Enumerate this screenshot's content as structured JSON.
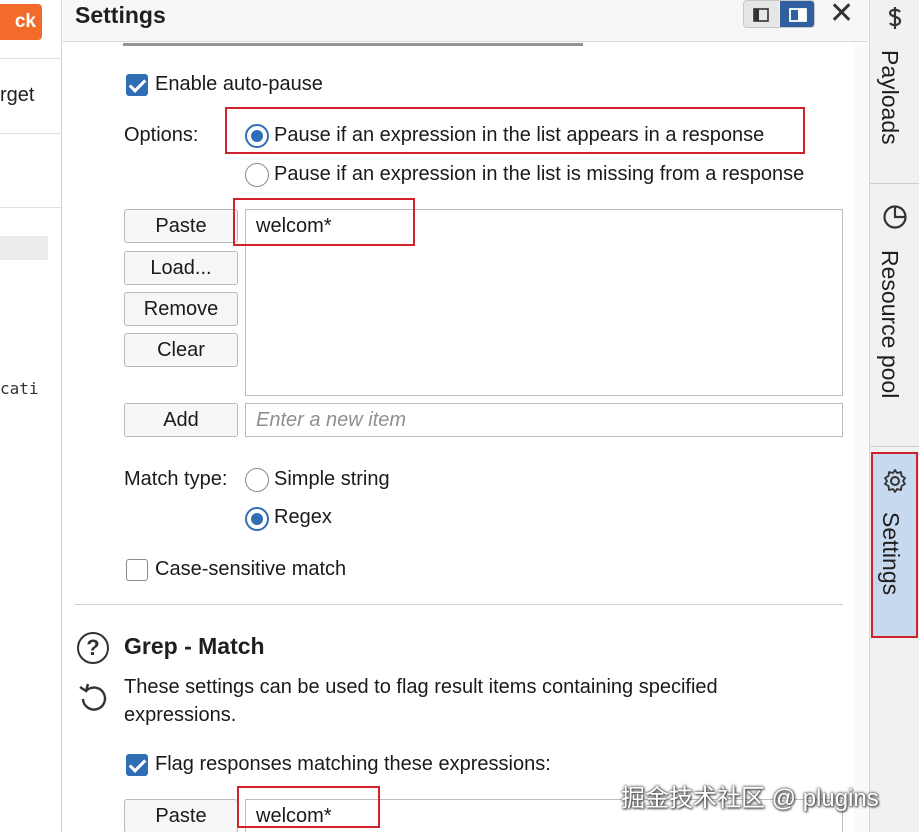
{
  "left_pane": {
    "button_label": "ck",
    "target_label": "rget",
    "mono_text": "cati"
  },
  "settings_panel": {
    "title": "Settings",
    "enable_auto_pause_label": "Enable auto-pause",
    "enable_auto_pause_checked": true,
    "options_label": "Options:",
    "option_appears_label": "Pause if an expression in the list appears in a response",
    "option_missing_label": "Pause if an expression in the list is missing from a response",
    "selected_option": "appears",
    "list_buttons": {
      "paste": "Paste",
      "load": "Load...",
      "remove": "Remove",
      "clear": "Clear",
      "add": "Add"
    },
    "list_items": [
      "welcom*"
    ],
    "new_item_placeholder": "Enter a new item",
    "match_type_label": "Match type:",
    "match_simple_label": "Simple string",
    "match_regex_label": "Regex",
    "selected_match_type": "regex",
    "case_sensitive_label": "Case-sensitive match",
    "case_sensitive_checked": false
  },
  "grep_match": {
    "title": "Grep - Match",
    "description_line1": "These settings can be used to flag result items containing specified",
    "description_line2": "expressions.",
    "flag_label": "Flag responses matching these expressions:",
    "flag_checked": true,
    "paste_label": "Paste",
    "list_items": [
      "welcom*"
    ]
  },
  "right_tabs": [
    {
      "label": "Payloads",
      "icon": "dollar-icon",
      "active": false
    },
    {
      "label": "Resource pool",
      "icon": "pie-chart-icon",
      "active": false
    },
    {
      "label": "Settings",
      "icon": "gear-icon",
      "active": true
    }
  ],
  "watermark": "掘金技术社区 @ plugins",
  "colors": {
    "accent_blue": "#2f6eb5",
    "highlight_red": "#d0222c",
    "active_tab_bg": "#c7d9ef",
    "orange_button": "#f26b2a"
  }
}
